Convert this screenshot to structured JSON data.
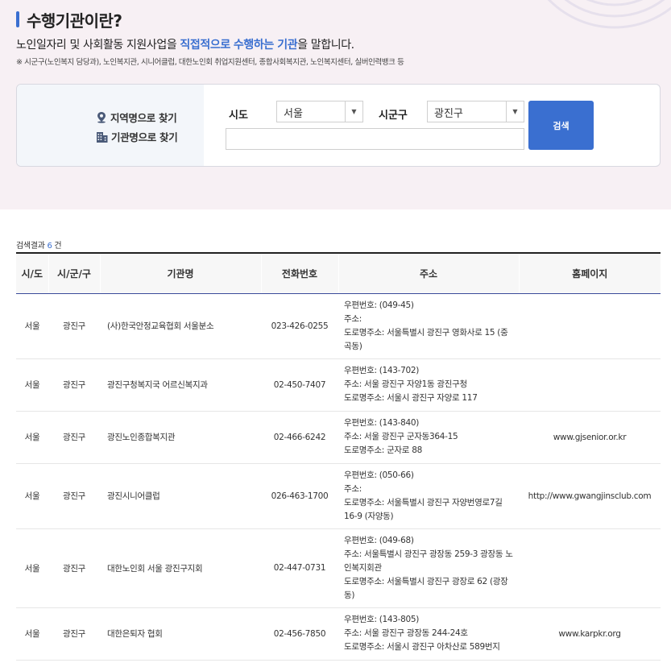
{
  "header": {
    "title": "수행기관이란?",
    "subtitle_prefix": "노인일자리 및 사회활동 지원사업을 ",
    "subtitle_hl1": "직접적으로",
    "subtitle_mid": " ",
    "subtitle_hl2": "수행하는 기관",
    "subtitle_suffix": "을 말합니다.",
    "note": "※ 시군구(노인복지 담당과), 노인복지관, 시니어클럽, 대한노인회 취업지원센터, 종합사회복지관, 노인복지센터, 실버인력뱅크 등"
  },
  "search": {
    "mode_region": "지역명으로 찾기",
    "mode_org": "기관명으로 찾기",
    "sido_label": "시도",
    "sido_value": "서울",
    "sigungu_label": "시군구",
    "sigungu_value": "광진구",
    "keyword_value": "",
    "button_label": "검색"
  },
  "results": {
    "count_prefix": "검색결과 ",
    "count": "6",
    "count_suffix": " 건",
    "columns": [
      "시/도",
      "시/군/구",
      "기관명",
      "전화번호",
      "주소",
      "홈페이지"
    ],
    "rows": [
      {
        "sido": "서울",
        "sigungu": "광진구",
        "name": "(사)한국안정교육협회 서울분소",
        "phone": "023-426-0255",
        "addr1": "우편번호:  (049-45)",
        "addr2": "주소:",
        "addr3": "도로명주소:  서울특별시 광진구 영화사로 15 (중곡동)",
        "home": ""
      },
      {
        "sido": "서울",
        "sigungu": "광진구",
        "name": "광진구청복지국 어르신복지과",
        "phone": "02-450-7407",
        "addr1": "우편번호:  (143-702)",
        "addr2": "주소:  서울 광진구 자양1동 광진구청",
        "addr3": "도로명주소:  서울시 광진구 자양로 117",
        "home": ""
      },
      {
        "sido": "서울",
        "sigungu": "광진구",
        "name": "광진노인종합복지관",
        "phone": "02-466-6242",
        "addr1": "우편번호:  (143-840)",
        "addr2": "주소:  서울 광진구 군자동364-15",
        "addr3": "도로명주소:  군자로 88",
        "home": "www.gjsenior.or.kr"
      },
      {
        "sido": "서울",
        "sigungu": "광진구",
        "name": "광진시니어클럽",
        "phone": "026-463-1700",
        "addr1": "우편번호:  (050-66)",
        "addr2": "주소:",
        "addr3": "도로명주소:  서울특별시 광진구 자양번영로7길 16-9 (자양동)",
        "home": "http://www.gwangjinsclub.com"
      },
      {
        "sido": "서울",
        "sigungu": "광진구",
        "name": "대한노인회 서울 광진구지회",
        "phone": "02-447-0731",
        "addr1": "우편번호:  (049-68)",
        "addr2": "주소:  서울특별시 광진구 광장동 259-3 광장동 노인복지회관",
        "addr3": "도로명주소:  서울특별시 광진구 광장로 62 (광장동)",
        "home": ""
      },
      {
        "sido": "서울",
        "sigungu": "광진구",
        "name": "대한은퇴자 협회",
        "phone": "02-456-7850",
        "addr1": "우편번호:  (143-805)",
        "addr2": "주소:  서울 광진구 광장동 244-24호",
        "addr3": "도로명주소:  서울시 광진구 아차산로 589번지",
        "home": "www.karpkr.org"
      }
    ]
  }
}
